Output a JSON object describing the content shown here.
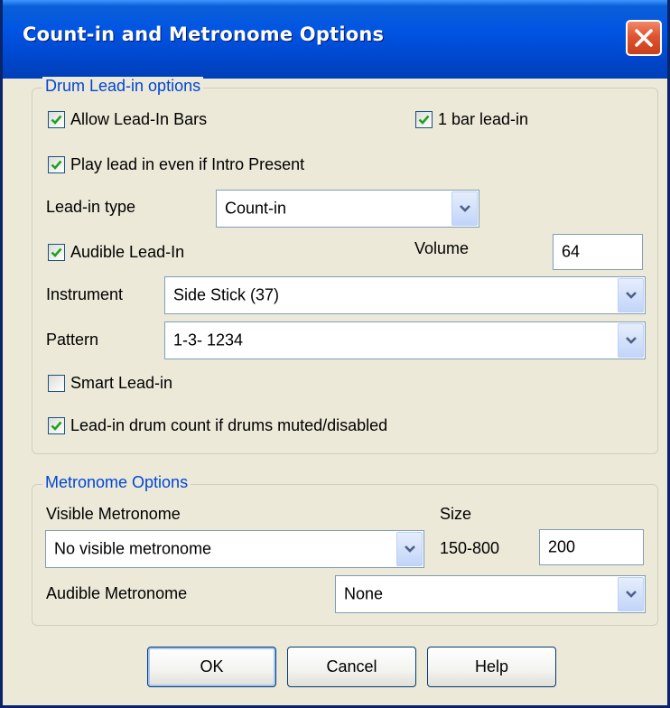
{
  "dialog": {
    "title": "Count-in and Metronome Options"
  },
  "drum_lead_in": {
    "group_label": "Drum Lead-in options",
    "allow_lead_in_bars": {
      "label": "Allow Lead-In Bars",
      "checked": true
    },
    "one_bar_lead_in": {
      "label": "1 bar lead-in",
      "checked": true
    },
    "play_lead_in_intro": {
      "label": "Play lead in even if Intro Present",
      "checked": true
    },
    "lead_in_type": {
      "label": "Lead-in type",
      "value": "Count-in"
    },
    "audible_lead_in": {
      "label": "Audible Lead-In",
      "checked": true
    },
    "volume": {
      "label": "Volume",
      "value": "64"
    },
    "instrument": {
      "label": "Instrument",
      "value": "Side Stick (37)"
    },
    "pattern": {
      "label": "Pattern",
      "value": "1-3- 1234"
    },
    "smart_lead_in": {
      "label": "Smart Lead-in",
      "checked": false
    },
    "drum_count_muted": {
      "label": "Lead-in drum count if drums muted/disabled",
      "checked": true
    }
  },
  "metronome": {
    "group_label": "Metronome Options",
    "visible_label": "Visible Metronome",
    "visible_value": "No visible metronome",
    "size_label": "Size",
    "size_range": "150-800",
    "size_value": "200",
    "audible_label": "Audible Metronome",
    "audible_value": "None"
  },
  "buttons": {
    "ok": "OK",
    "cancel": "Cancel",
    "help": "Help"
  },
  "colors": {
    "title_bar": "#0054e3",
    "group_label": "#0046d5",
    "check_mark": "#21a121",
    "close_button": "#e0532f"
  }
}
